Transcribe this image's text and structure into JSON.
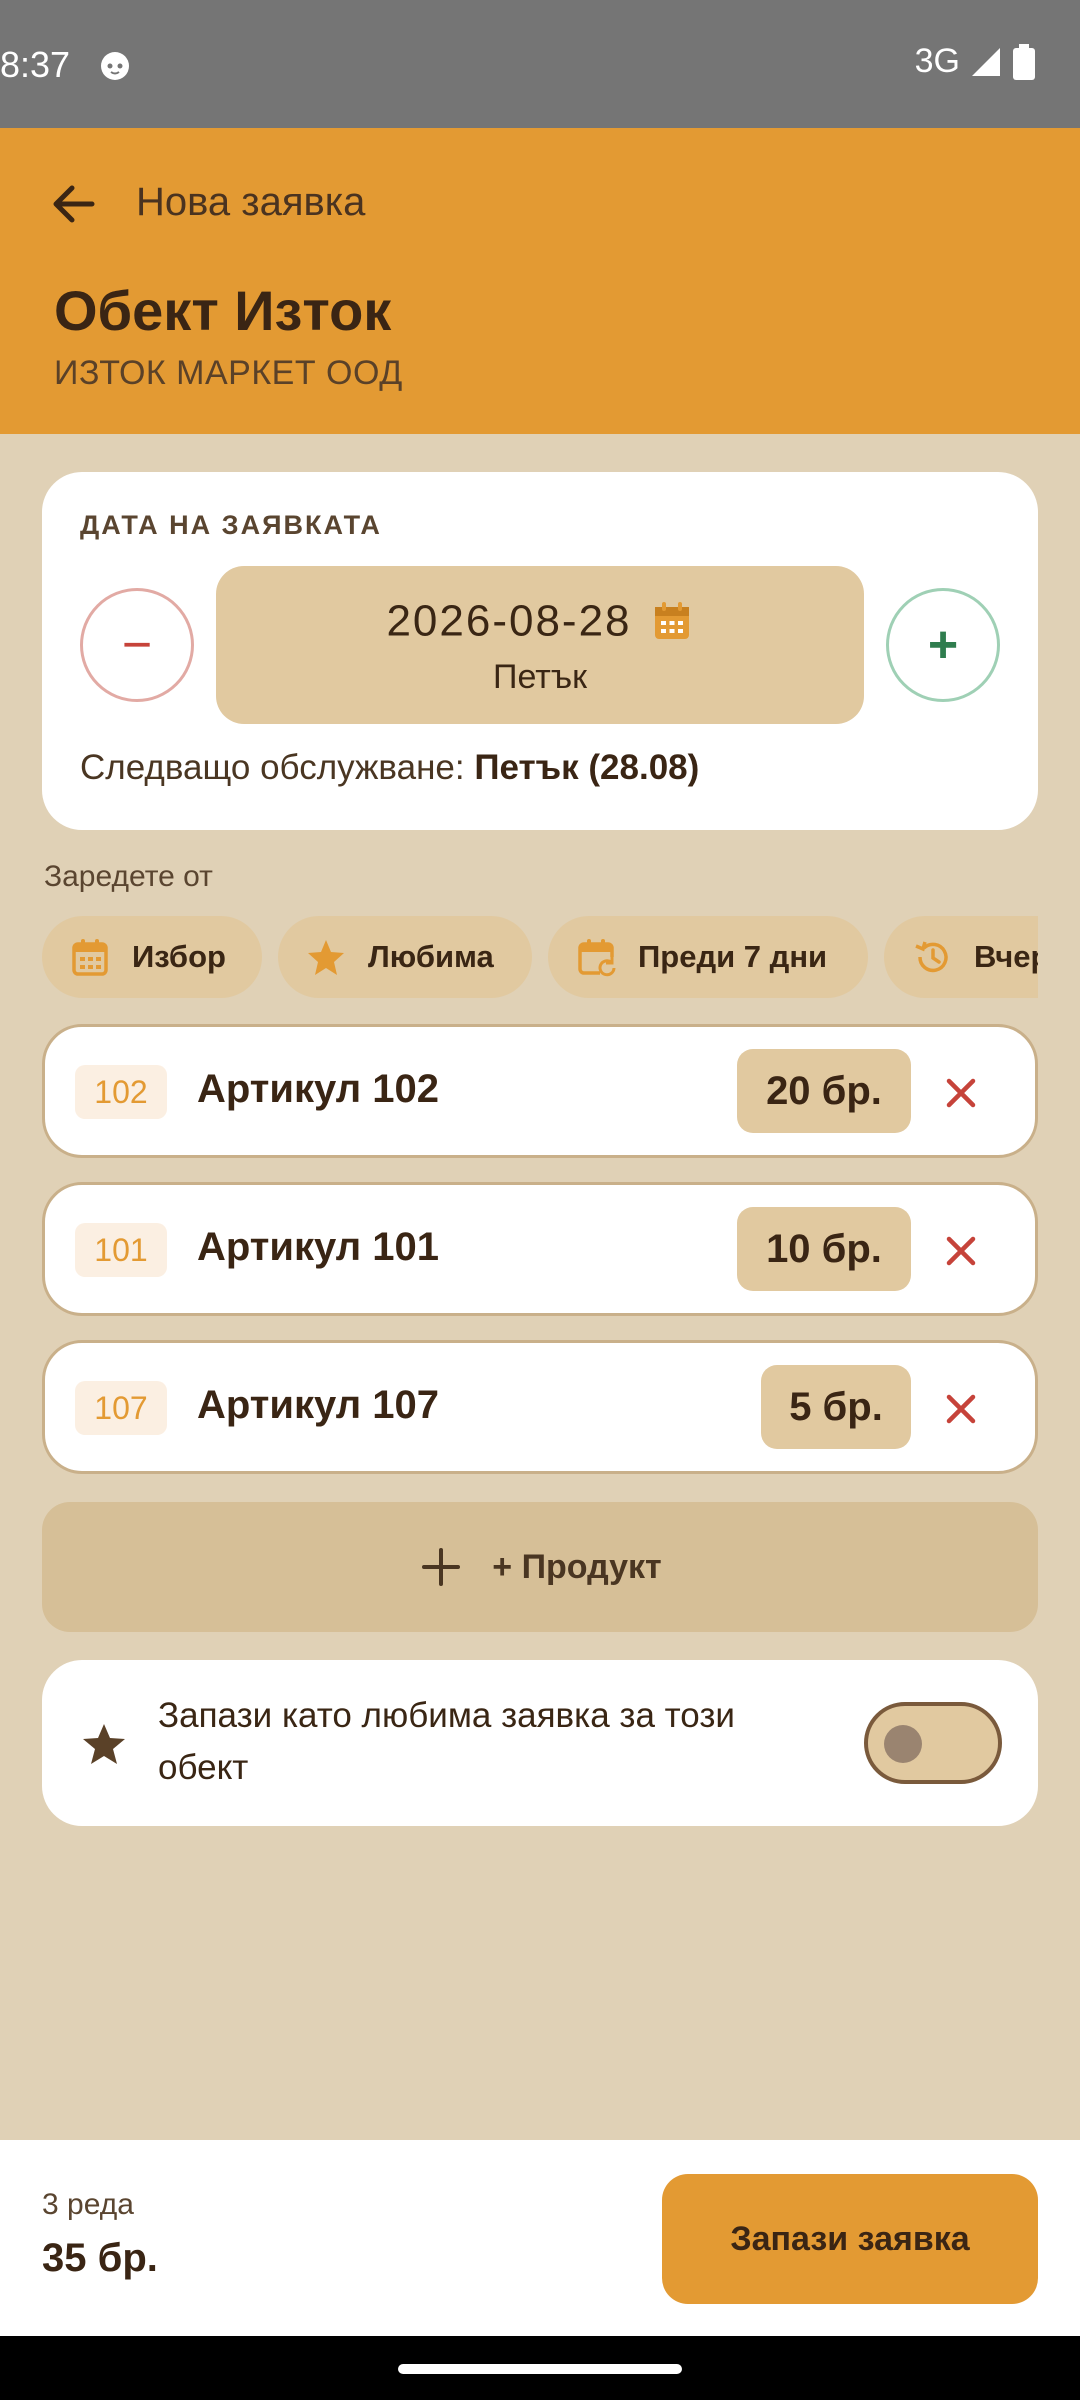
{
  "status": {
    "time": "8:37",
    "network": "3G"
  },
  "appbar": {
    "title": "Нова заявка",
    "object_name": "Обект Изток",
    "company": "ИЗТОК МАРКЕТ ООД"
  },
  "date_card": {
    "label": "ДАТА НА ЗАЯВКАТА",
    "date": "2026-08-28",
    "weekday": "Петък",
    "minus": "−",
    "plus": "+",
    "next_service_label": "Следващо обслужване:",
    "next_service_value": "Петък (28.08)"
  },
  "load_from": {
    "label": "Заредете от",
    "chips": [
      {
        "label": "Избор",
        "icon": "calendar-icon"
      },
      {
        "label": "Любима",
        "icon": "star-icon"
      },
      {
        "label": "Преди 7 дни",
        "icon": "calendar-refresh-icon"
      },
      {
        "label": "Вчера",
        "icon": "history-icon"
      }
    ]
  },
  "items": [
    {
      "code": "102",
      "name": "Артикул 102",
      "qty": "20 бр."
    },
    {
      "code": "101",
      "name": "Артикул 101",
      "qty": "10 бр."
    },
    {
      "code": "107",
      "name": "Артикул 107",
      "qty": "5 бр."
    }
  ],
  "add_product_label": "+ Продукт",
  "favorite": {
    "text": "Запази като любима заявка за този обект",
    "enabled": false
  },
  "summary": {
    "rows": "3 реда",
    "total": "35 бр.",
    "save_label": "Запази заявка"
  },
  "colors": {
    "primary": "#e39a33",
    "background": "#e0d1b6",
    "chip": "#e1c9a0",
    "danger": "#c6433a",
    "success": "#2f7d4e"
  }
}
